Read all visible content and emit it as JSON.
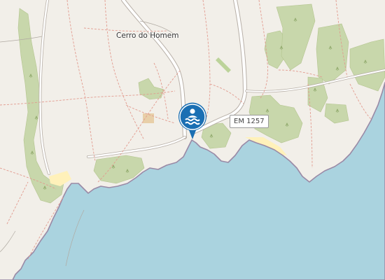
{
  "map": {
    "place_label": "Cerro do Homem",
    "road_ref": "EM 1257",
    "marker": {
      "icon": "swimming-icon",
      "color": "#1a6fb3"
    },
    "colors": {
      "land": "#f2efe9",
      "sea": "#aad3df",
      "scrub": "#c8d7ab",
      "coastline": "#9a8aa6",
      "beach": "#fff1ba",
      "track": "#e29b8f"
    }
  }
}
